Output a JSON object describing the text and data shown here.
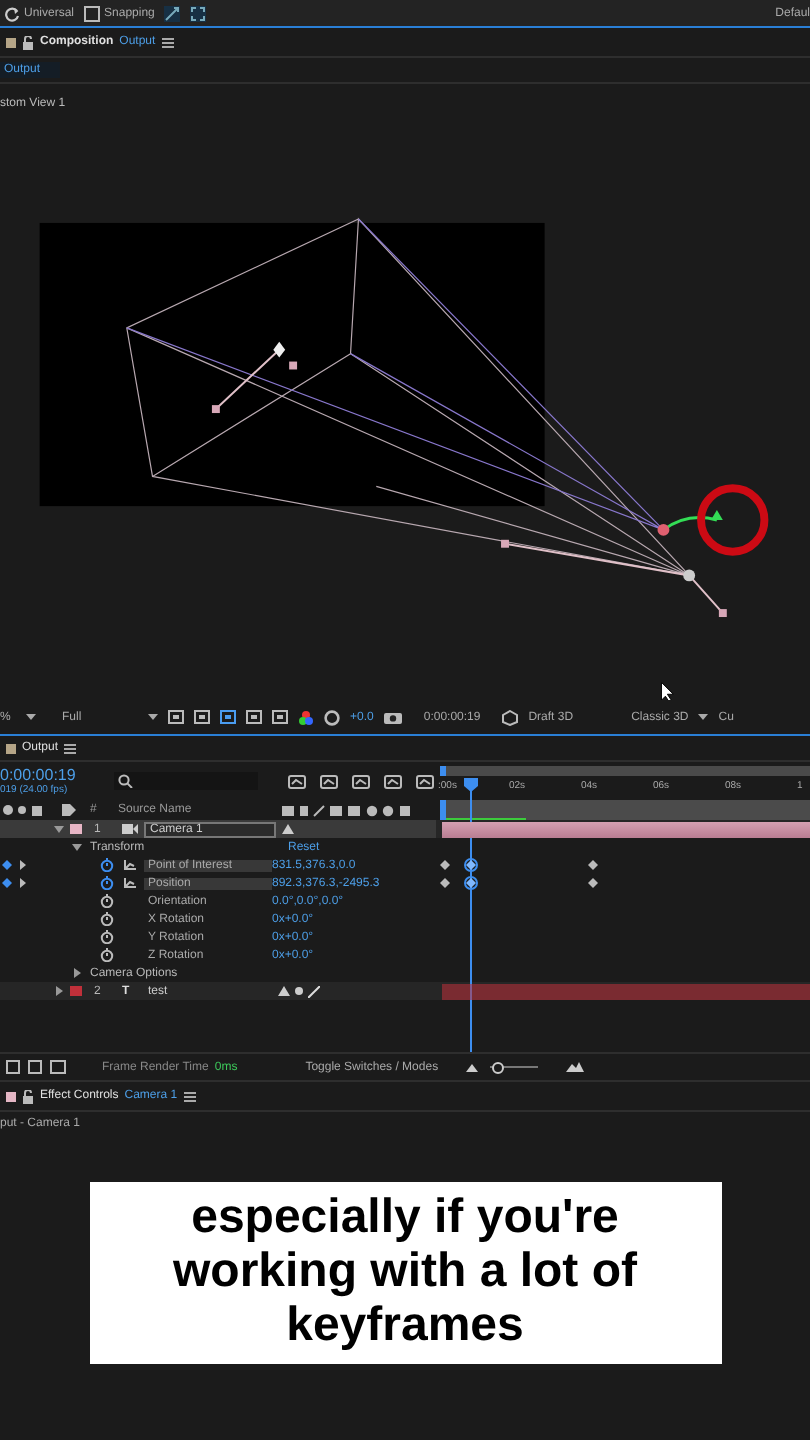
{
  "top_bar": {
    "tools": [
      {
        "kind": "refresh",
        "label": "Universal"
      },
      {
        "kind": "checkbox",
        "label": "Snapping",
        "checked": false
      }
    ],
    "workspace": "Defaul"
  },
  "composition_panel": {
    "title": "Composition",
    "comp": "Output",
    "tab": "Output",
    "view_label": "stom View 1"
  },
  "viewer_toolbar": {
    "zoom": "%",
    "resolution": "Full",
    "exposure": "+0.0",
    "timecode": "0:00:00:19",
    "renderer": "Draft 3D",
    "view": "Classic 3D",
    "extra": "Cu"
  },
  "timeline": {
    "tab": "Output",
    "timecode": "0:00:00:19",
    "fps": "019 (24.00 fps)",
    "columns": [
      "#",
      "Source Name"
    ],
    "render_cache": {
      "level": 0.22
    },
    "zoom_slider": {
      "level": 0.15
    },
    "ruler": [
      ":00s",
      "02s",
      "04s",
      "06s",
      "08s",
      "1"
    ],
    "rows": [
      {
        "kind": "camera",
        "number": "1",
        "name": "Camera 1",
        "color": "#e8b6c6",
        "selected": true,
        "expanded": true
      },
      {
        "kind": "group",
        "name": "Transform",
        "value": "Reset",
        "expanded": true
      },
      {
        "kind": "property",
        "name": "Point of Interest",
        "value": "831.5,376.3,0.0",
        "keyframed": true,
        "selected": true
      },
      {
        "kind": "property",
        "name": "Position",
        "value": "892.3,376.3,-2495.3",
        "keyframed": true,
        "selected": true
      },
      {
        "kind": "property",
        "name": "Orientation",
        "value": "0.0°,0.0°,0.0°",
        "keyframed": false,
        "selected": false
      },
      {
        "kind": "property",
        "name": "X Rotation",
        "value": "0x+0.0°",
        "keyframed": false,
        "selected": false
      },
      {
        "kind": "property",
        "name": "Y Rotation",
        "value": "0x+0.0°",
        "keyframed": false,
        "selected": false
      },
      {
        "kind": "property",
        "name": "Z Rotation",
        "value": "0x+0.0°",
        "keyframed": false,
        "selected": false
      },
      {
        "kind": "group",
        "name": "Camera Options",
        "expanded": false
      },
      {
        "kind": "text",
        "number": "2",
        "name": "test",
        "color": "#c0303a",
        "selected": false,
        "expanded": false,
        "type_glyph": "T"
      }
    ],
    "footer": {
      "label": "Frame Render Time",
      "value": "0ms",
      "toggle": "Toggle Switches / Modes"
    }
  },
  "effect_controls": {
    "title": "Effect Controls",
    "layer": "Camera 1",
    "subtitle": "put - Camera 1"
  },
  "caption": "especially if you're working with a lot of keyframes"
}
